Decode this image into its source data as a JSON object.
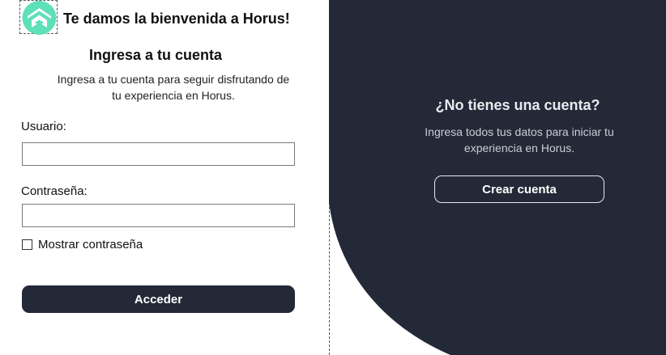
{
  "header": {
    "welcome": "Te damos la bienvenida a Horus!"
  },
  "login": {
    "title": "Ingresa a tu cuenta",
    "subtitle": "Ingresa a tu cuenta para seguir disfrutando de tu experiencia en Horus.",
    "user_label": "Usuario:",
    "user_value": "",
    "password_label": "Contraseña:",
    "password_value": "",
    "show_password_label": "Mostrar contraseña",
    "show_password_checked": false,
    "submit_label": "Acceder"
  },
  "signup": {
    "title": "¿No tienes una cuenta?",
    "subtitle": "Ingresa todos tus datos para iniciar tu experiencia en Horus.",
    "button_label": "Crear cuenta"
  },
  "colors": {
    "dark_panel": "#232937",
    "logo_green": "#5ee0b8"
  },
  "icons": {
    "logo": "horus-logo-icon",
    "checkbox": "checkbox-icon"
  }
}
